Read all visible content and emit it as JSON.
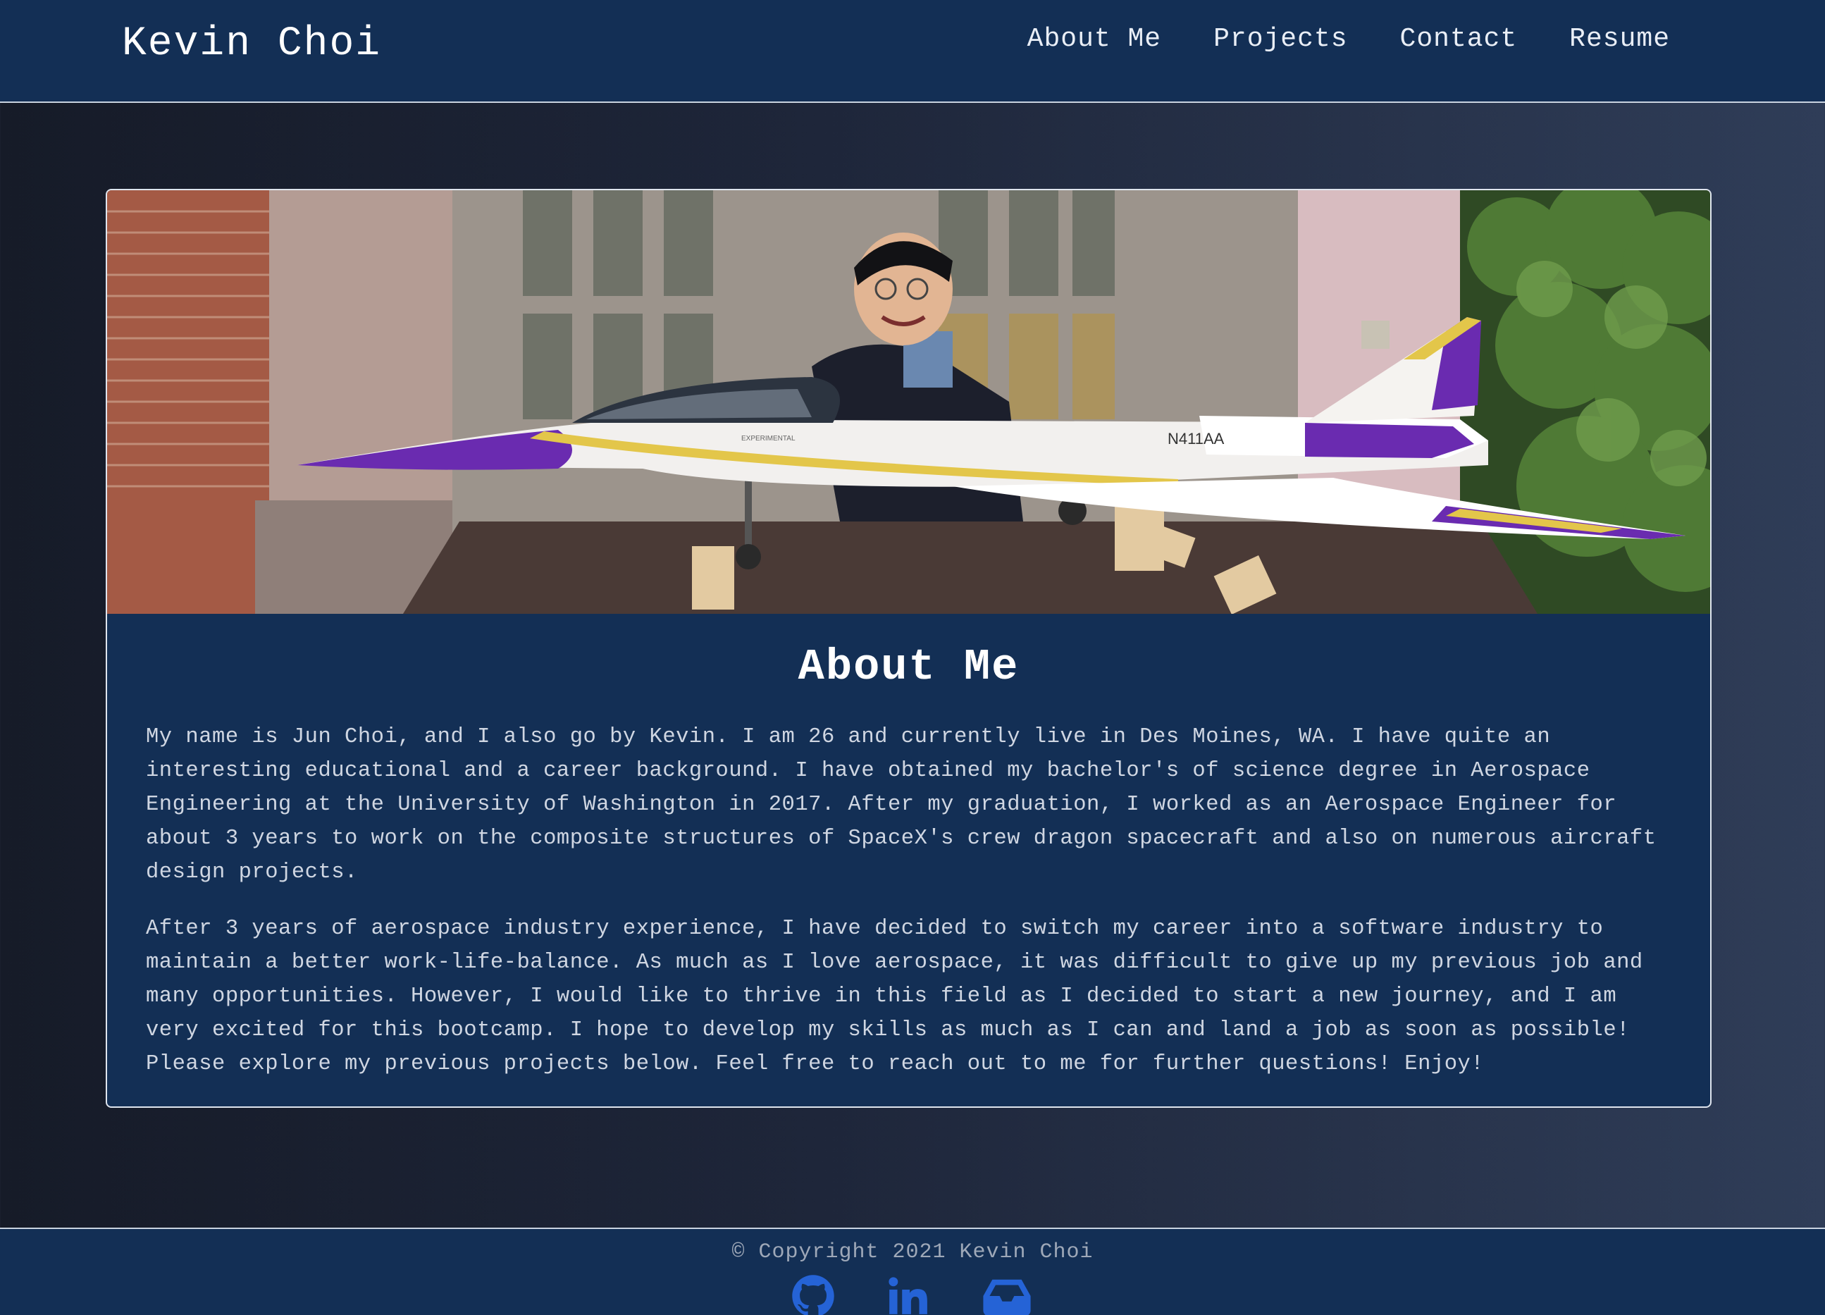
{
  "navbar": {
    "brand": "Kevin Choi",
    "links": [
      {
        "label": "About Me"
      },
      {
        "label": "Projects"
      },
      {
        "label": "Contact"
      },
      {
        "label": "Resume"
      }
    ]
  },
  "about": {
    "photo_tail_number": "N411AA",
    "photo_fuselage_text": "EXPERIMENTAL",
    "title": "About Me",
    "paragraphs": [
      "My name is Jun Choi, and I also go by Kevin. I am 26 and currently live in Des Moines, WA. I have quite an interesting educational and a career background. I have obtained my bachelor's of science degree in Aerospace Engineering at the University of Washington in 2017. After my graduation, I worked as an Aerospace Engineer for about 3 years to work on the composite structures of SpaceX's crew dragon spacecraft and also on numerous aircraft design projects.",
      "After 3 years of aerospace industry experience, I have decided to switch my career into a software industry to maintain a better work-life-balance. As much as I love aerospace, it was difficult to give up my previous job and many opportunities. However, I would like to thrive in this field as I decided to start a new journey, and I am very excited for this bootcamp. I hope to develop my skills as much as I can and land a job as soon as possible! Please explore my previous projects below. Feel free to reach out to me for further questions! Enjoy!"
    ]
  },
  "footer": {
    "copyright": "© Copyright 2021 Kevin Choi",
    "social": [
      {
        "icon": "github-icon"
      },
      {
        "icon": "linkedin-icon"
      },
      {
        "icon": "inbox-icon"
      }
    ]
  },
  "colors": {
    "navbar_bg": "#132f55",
    "social_icon": "#2563d6",
    "jet_accent": "#6a2bb0",
    "jet_stripe": "#e3c64a"
  }
}
